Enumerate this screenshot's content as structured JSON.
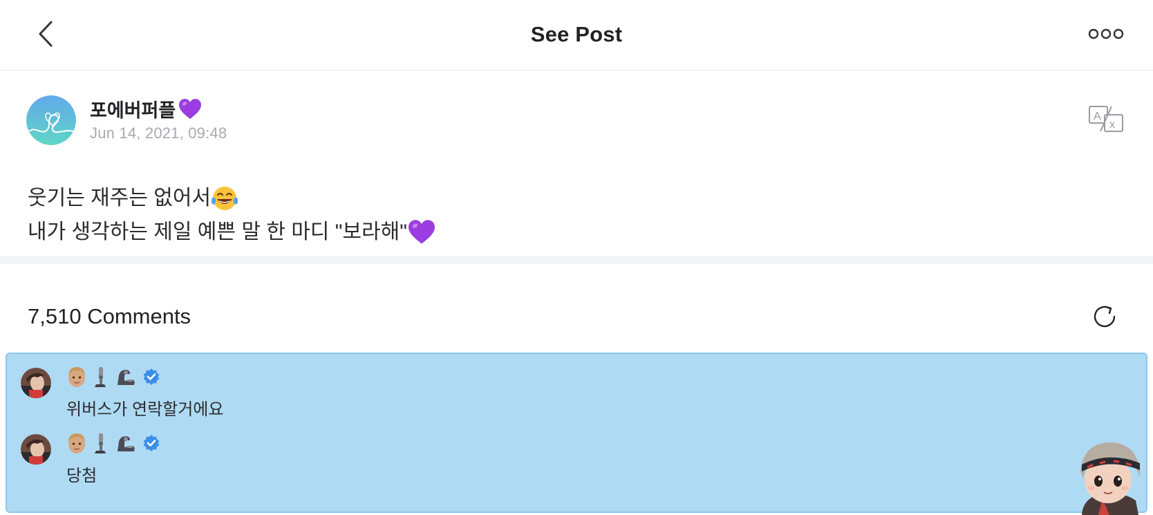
{
  "header": {
    "title": "See Post",
    "back_icon": "chevron-left-icon",
    "more_icon": "more-dots-icon"
  },
  "post": {
    "author": "포에버퍼플",
    "author_emoji": "purple-heart",
    "date": "Jun 14, 2021, 09:48",
    "translate_icon": "translate-icon",
    "lines": [
      {
        "text": "웃기는 재주는 없어서",
        "emoji": "face-with-tears-of-joy"
      },
      {
        "text": "내가 생각하는 제일 예쁜 말 한 마디 \"보라해\"",
        "emoji": "purple-heart"
      }
    ]
  },
  "comments": {
    "count_label": "7,510 Comments",
    "refresh_icon": "refresh-icon",
    "items": [
      {
        "author_icons": [
          "man-face-emoji",
          "mechanical-leg-emoji",
          "mechanical-arm-emoji",
          "verified-badge-icon"
        ],
        "text": "위버스가 연락할거에요"
      },
      {
        "author_icons": [
          "man-face-emoji",
          "mechanical-leg-emoji",
          "mechanical-arm-emoji",
          "verified-badge-icon"
        ],
        "text": "당첨"
      }
    ]
  },
  "colors": {
    "panel_bg": "#afdaf3",
    "panel_border": "#8fc6ea",
    "heart": "#9b3de0",
    "verified": "#3b8fe8",
    "divider": "#f3f4f8"
  }
}
